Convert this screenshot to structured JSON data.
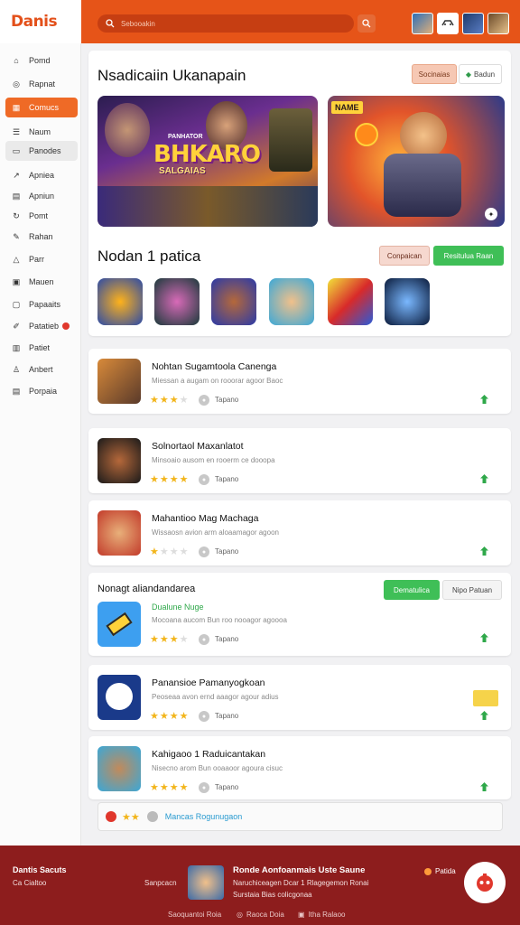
{
  "brand": {
    "logo": "Danis",
    "accent": "#e65418"
  },
  "search": {
    "placeholder": "Sebooakin",
    "icon": "search-icon"
  },
  "sidebar": {
    "items": [
      {
        "label": "Pomd",
        "icon": "home-icon"
      },
      {
        "label": "Rapnat",
        "icon": "compass-icon"
      },
      {
        "label": "Comucs",
        "icon": "grid-icon",
        "active": true
      },
      {
        "label": "Naum",
        "icon": "list-icon"
      },
      {
        "label": "Panodes",
        "icon": "gamepad-icon",
        "highlight": true
      },
      {
        "label": "Apniea",
        "icon": "share-icon"
      },
      {
        "label": "Apniun",
        "icon": "calendar-icon"
      },
      {
        "label": "Pomt",
        "icon": "refresh-icon"
      },
      {
        "label": "Rahan",
        "icon": "pencil-icon"
      },
      {
        "label": "Parr",
        "icon": "bell-icon"
      },
      {
        "label": "Mauen",
        "icon": "film-icon"
      },
      {
        "label": "Papaaits",
        "icon": "file-icon"
      },
      {
        "label": "Patatieb",
        "icon": "edit-icon",
        "badge": true
      },
      {
        "label": "Patiet",
        "icon": "bookmark-icon"
      },
      {
        "label": "Anbert",
        "icon": "trophy-icon"
      },
      {
        "label": "Porpaia",
        "icon": "book-icon"
      }
    ]
  },
  "featured": {
    "title": "Nsadicaiin Ukanapain",
    "btn_primary": "Socinaias",
    "btn_secondary": "Badun",
    "banner1_title": "BHKARO",
    "banner1_sub": "SALGAIAS",
    "banner1_tag": "PANHATOR",
    "banner2_tag": "NAME"
  },
  "popular": {
    "title": "Nodan 1 patica",
    "btn_secondary": "Conpaican",
    "btn_primary": "Resitulua Raan"
  },
  "games": [
    {
      "title": "Nohtan Sugamtoola Canenga",
      "desc": "Miessan a augam on rooorar agoor Baoc",
      "rating": 3,
      "meta": "Tapano"
    },
    {
      "title": "Solnortaol Maxanlatot",
      "desc": "Minsoaio ausom en rooerm ce dooopa",
      "rating": 4,
      "meta": "Tapano"
    },
    {
      "title": "Mahantioo Mag Machaga",
      "desc": "Wissaosn avion arm aloaamagor agoon",
      "rating": 1,
      "meta": "Tapano"
    }
  ],
  "section2": {
    "title": "Nonagt aliandandarea",
    "btn_primary": "Dematulica",
    "btn_secondary": "Nipo Patuan",
    "first_tag": "Dualune Nuge"
  },
  "games2": [
    {
      "title": "",
      "desc": "Mocoana aucom Bun roo nooagor agoooa",
      "rating": 3,
      "meta": "Tapano"
    },
    {
      "title": "Panansioe Pamanyogkoan",
      "desc": "Peoseaa avon ernd aaagor agour adius",
      "rating": 4,
      "meta": "Tapano"
    },
    {
      "title": "Kahigaoo 1 Raduicantakan",
      "desc": "Nisecno arom Bun ooaaoor agoura cisuc",
      "rating": 4,
      "meta": "Tapano"
    }
  ],
  "notice": {
    "text": "Mancas Rogunugaon"
  },
  "footer": {
    "brand": "Dantis Sacuts",
    "brand_sub": "Ca Cialtoo",
    "left": "Sanpcacn",
    "title": "Ronde Aonfoanmais Uste Saune",
    "line1": "Naruchiceagen Dcar 1 Rlagegemon Ronai",
    "line2": "Surstaia Bias colicgonaa",
    "right": "Patida",
    "link1": "Saoquantoi Roia",
    "link2": "Raoca Doia",
    "link3": "Itha Ralaoo"
  }
}
